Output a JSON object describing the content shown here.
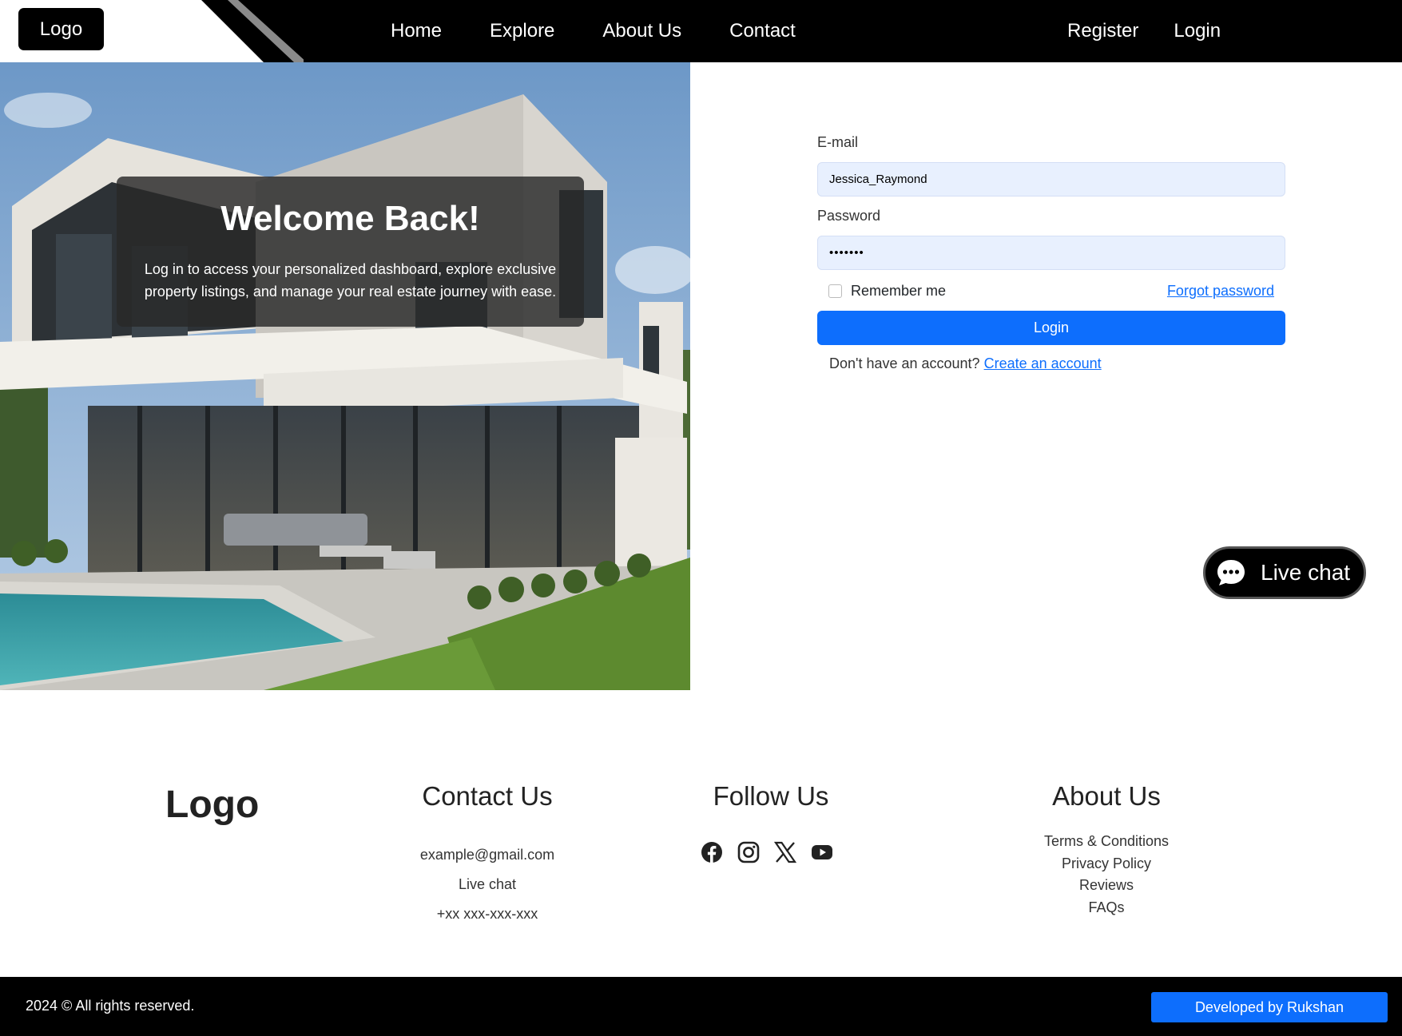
{
  "header": {
    "logo": "Logo",
    "nav": [
      "Home",
      "Explore",
      "About Us",
      "Contact"
    ],
    "auth": [
      "Register",
      "Login"
    ]
  },
  "hero": {
    "title": "Welcome Back!",
    "text": "Log in to access your personalized dashboard, explore exclusive property listings, and manage your real estate journey with ease."
  },
  "form": {
    "email_label": "E-mail",
    "email_value": "Jessica_Raymond",
    "password_label": "Password",
    "password_value": "•••••••",
    "remember_label": "Remember me",
    "forgot_link": "Forgot password",
    "login_button": "Login",
    "signup_prompt": "Don't have an account?",
    "signup_link": "Create an account"
  },
  "live_chat": {
    "label": "Live chat"
  },
  "footer": {
    "logo": "Logo",
    "contact": {
      "title": "Contact Us",
      "items": [
        "example@gmail.com",
        "Live chat",
        "+xx xxx-xxx-xxx"
      ]
    },
    "follow": {
      "title": "Follow Us",
      "icons": [
        "facebook-icon",
        "instagram-icon",
        "x-icon",
        "youtube-icon"
      ]
    },
    "about": {
      "title": "About Us",
      "items": [
        "Terms & Conditions",
        "Privacy Policy",
        "Reviews",
        "FAQs"
      ]
    },
    "copyright": "2024 © All rights reserved.",
    "developer": "Developed by Rukshan"
  },
  "colors": {
    "accent": "#0d6efd",
    "header_bg": "#000000",
    "input_bg": "#e8f0fe"
  }
}
